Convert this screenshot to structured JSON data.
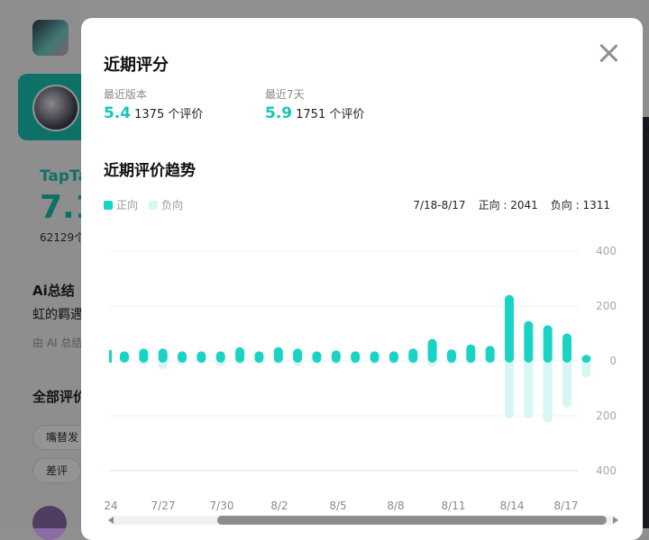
{
  "background": {
    "brand": "TapTa",
    "score": "7.1",
    "count": "62129个",
    "ai_title": "Ai总结",
    "ai_text": "虹的羁遇",
    "ai_footer": "由 AI 总结",
    "all_reviews": "全部评价",
    "chips": [
      "嘴替发",
      "差评"
    ],
    "right_glyph": "×"
  },
  "modal": {
    "title": "近期评分",
    "latest_version": {
      "label": "最近版本",
      "score": "5.4",
      "count": "1375 个评价"
    },
    "last_7_days": {
      "label": "最近7天",
      "score": "5.9",
      "count": "1751 个评价"
    },
    "trend_title": "近期评价趋势",
    "legend_positive": "正向",
    "legend_negative": "负向",
    "range": "7/18-8/17",
    "positive_summary": "正向 : 2041",
    "negative_summary": "负向 : 1311"
  },
  "colors": {
    "positive": "#19d3c4",
    "negative": "#d8f6f4",
    "accent": "#15c5b5"
  },
  "chart_data": {
    "type": "bar",
    "x_tick_labels": [
      "24",
      "7/27",
      "7/30",
      "8/2",
      "8/5",
      "8/8",
      "8/11",
      "8/14",
      "8/17"
    ],
    "y_tick_labels": [
      "400",
      "200",
      "0",
      "200",
      "400"
    ],
    "ylim": [
      -400,
      400
    ],
    "series": [
      {
        "name": "正向",
        "values": [
          35,
          45,
          45,
          35,
          35,
          35,
          50,
          35,
          50,
          45,
          35,
          38,
          35,
          35,
          35,
          45,
          80,
          42,
          60,
          55,
          240,
          145,
          130,
          100,
          22
        ]
      },
      {
        "name": "负向",
        "values": [
          -5,
          -15,
          -30,
          -15,
          -10,
          -20,
          -12,
          -10,
          -12,
          -20,
          -10,
          -12,
          -10,
          -12,
          -12,
          -12,
          -20,
          -12,
          -10,
          -8,
          -210,
          -210,
          -225,
          -170,
          -60
        ]
      }
    ]
  }
}
